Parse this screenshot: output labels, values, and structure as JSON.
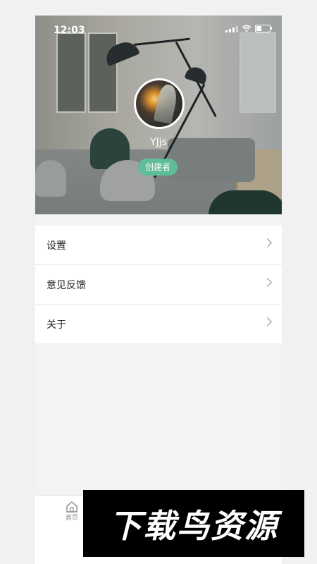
{
  "status_bar": {
    "time": "12:03"
  },
  "profile": {
    "username": "YJjs",
    "role_badge": "创建者"
  },
  "menu": {
    "items": [
      {
        "label": "设置"
      },
      {
        "label": "意见反馈"
      },
      {
        "label": "关于"
      }
    ]
  },
  "tabbar": {
    "home_label": "首页"
  },
  "watermark": {
    "text": "下载鸟资源"
  },
  "colors": {
    "badge": "#5fbd97",
    "background": "#f2f3f5"
  }
}
